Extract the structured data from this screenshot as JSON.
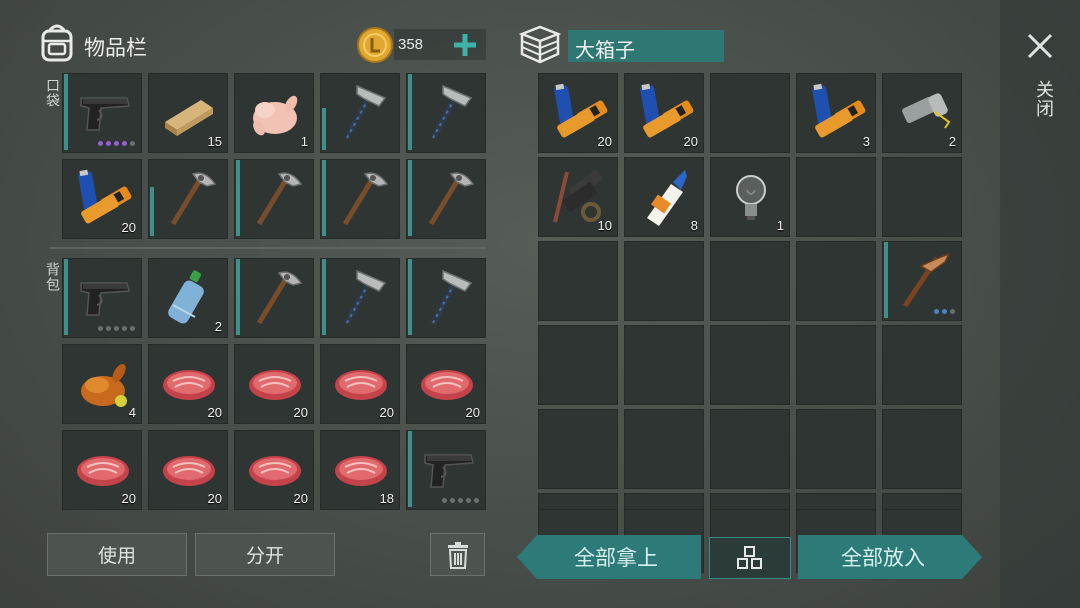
{
  "inventory": {
    "title": "物品栏",
    "coins": "358",
    "pocket_label": "口袋",
    "backpack_label": "背包",
    "pocket": [
      {
        "icon": "pistol-icon",
        "qty": "",
        "dots": [
          "#9a5fd6",
          "#9a5fd6",
          "#9a5fd6",
          "#9a5fd6",
          "#6b716d"
        ],
        "durability": 1.0
      },
      {
        "icon": "wood-plank-icon",
        "qty": "15"
      },
      {
        "icon": "raw-chicken-icon",
        "qty": "1"
      },
      {
        "icon": "hammer-icon",
        "qty": "",
        "durability": 0.55
      },
      {
        "icon": "hammer-icon",
        "qty": "",
        "durability": 1.0
      },
      {
        "icon": "batteries-icon",
        "qty": "20"
      },
      {
        "icon": "pickaxe-icon",
        "qty": "",
        "durability": 0.65
      },
      {
        "icon": "pickaxe-icon",
        "qty": "",
        "durability": 1.0
      },
      {
        "icon": "pickaxe-icon",
        "qty": "",
        "durability": 1.0
      },
      {
        "icon": "pickaxe-icon",
        "qty": "",
        "durability": 1.0
      }
    ],
    "backpack": [
      {
        "icon": "pistol-icon",
        "qty": "",
        "dots": [
          "#6b716d",
          "#6b716d",
          "#6b716d",
          "#6b716d",
          "#6b716d"
        ],
        "durability": 1.0
      },
      {
        "icon": "water-bottle-icon",
        "qty": "2"
      },
      {
        "icon": "pickaxe-icon",
        "qty": "",
        "durability": 1.0
      },
      {
        "icon": "hammer-icon",
        "qty": "",
        "durability": 1.0
      },
      {
        "icon": "hammer-icon",
        "qty": "",
        "durability": 1.0
      },
      {
        "icon": "roast-chicken-icon",
        "qty": "4"
      },
      {
        "icon": "raw-steak-icon",
        "qty": "20"
      },
      {
        "icon": "raw-steak-icon",
        "qty": "20"
      },
      {
        "icon": "raw-steak-icon",
        "qty": "20"
      },
      {
        "icon": "raw-steak-icon",
        "qty": "20"
      },
      {
        "icon": "raw-steak-icon",
        "qty": "20"
      },
      {
        "icon": "raw-steak-icon",
        "qty": "20"
      },
      {
        "icon": "raw-steak-icon",
        "qty": "20"
      },
      {
        "icon": "raw-steak-icon",
        "qty": "18"
      },
      {
        "icon": "pistol-icon",
        "qty": "",
        "dots": [
          "#6b716d",
          "#6b716d",
          "#6b716d",
          "#6b716d",
          "#6b716d"
        ],
        "durability": 1.0
      }
    ],
    "use_button": "使用",
    "split_button": "分开",
    "trash_icon": "trash-icon"
  },
  "container": {
    "title": "大箱子",
    "close_label": "关闭",
    "slots": [
      {
        "icon": "batteries-icon",
        "qty": "20"
      },
      {
        "icon": "batteries-icon",
        "qty": "20"
      },
      {
        "icon": "",
        "qty": ""
      },
      {
        "icon": "batteries-icon",
        "qty": "3"
      },
      {
        "icon": "flashlight-icon",
        "qty": "2"
      },
      {
        "icon": "scrap-parts-icon",
        "qty": "10"
      },
      {
        "icon": "glue-icon",
        "qty": "8"
      },
      {
        "icon": "light-bulb-icon",
        "qty": "1"
      },
      {
        "icon": "",
        "qty": ""
      },
      {
        "icon": "",
        "qty": ""
      },
      {
        "icon": "",
        "qty": ""
      },
      {
        "icon": "",
        "qty": ""
      },
      {
        "icon": "",
        "qty": ""
      },
      {
        "icon": "",
        "qty": ""
      },
      {
        "icon": "bone-pickaxe-icon",
        "qty": "",
        "dots": [
          "#4a86c4",
          "#4a86c4",
          "#6b716d"
        ],
        "durability": 1.0
      },
      {
        "icon": "",
        "qty": ""
      },
      {
        "icon": "",
        "qty": ""
      },
      {
        "icon": "",
        "qty": ""
      },
      {
        "icon": "",
        "qty": ""
      },
      {
        "icon": "",
        "qty": ""
      },
      {
        "icon": "",
        "qty": ""
      },
      {
        "icon": "",
        "qty": ""
      },
      {
        "icon": "",
        "qty": ""
      },
      {
        "icon": "",
        "qty": ""
      },
      {
        "icon": "",
        "qty": ""
      },
      {
        "icon": "",
        "qty": ""
      },
      {
        "icon": "",
        "qty": ""
      },
      {
        "icon": "",
        "qty": ""
      },
      {
        "icon": "",
        "qty": ""
      },
      {
        "icon": "",
        "qty": ""
      }
    ],
    "take_all_button": "全部拿上",
    "put_all_button": "全部放入",
    "sort_icon": "grid-sort-icon"
  },
  "colors": {
    "accent": "#2d7b78",
    "durability": "#3f8f8c",
    "coin": "#e0a830"
  }
}
